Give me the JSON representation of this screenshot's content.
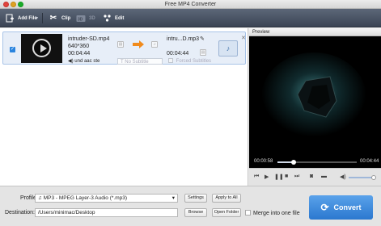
{
  "window": {
    "title": "Free MP4 Converter"
  },
  "toolbar": {
    "add_file": "Add File",
    "clip": "Clip",
    "three_d": "3D",
    "edit": "Edit"
  },
  "item": {
    "source_name": "intruder-SD.mp4",
    "resolution": "640*360",
    "source_duration": "00:04:44",
    "output_name": "intru...D.mp3",
    "output_duration": "00:04:44",
    "audio_track": "und aac ste",
    "subtitle": "No Subtitle",
    "forced_subtitles": "Forced Subtitles"
  },
  "preview": {
    "label": "Preview",
    "current_time": "00:00:58",
    "total_time": "00:04:44",
    "progress": 0.2,
    "volume": 0.9
  },
  "bottom": {
    "profile_label": "Profile:",
    "profile_value": "MP3 - MPEG Layer-3 Audio (*.mp3)",
    "settings": "Settings",
    "apply_to_all": "Apply to All",
    "destination_label": "Destination:",
    "destination_value": "/Users/minimac/Desktop",
    "browse": "Browse",
    "open_folder": "Open Folder",
    "merge": "Merge into one file",
    "convert": "Convert"
  }
}
